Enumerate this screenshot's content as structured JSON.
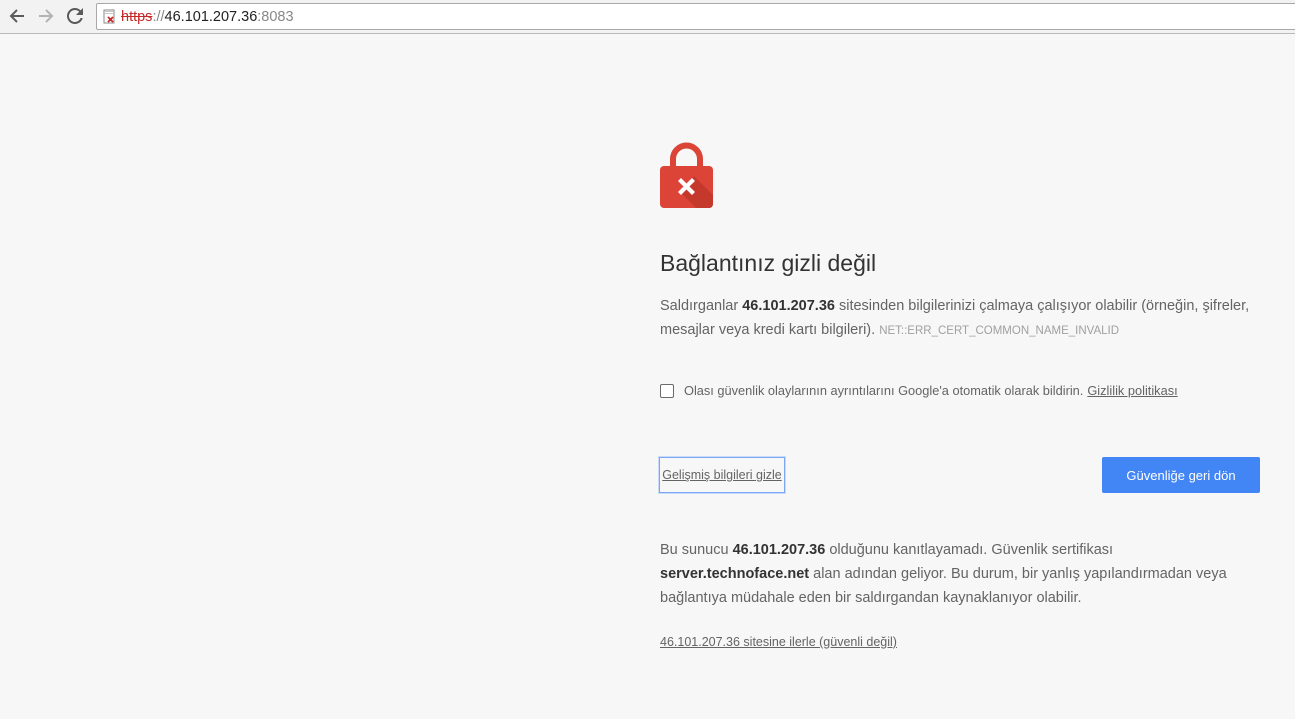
{
  "browser": {
    "back_icon": "arrow-left-icon",
    "forward_icon": "arrow-right-icon",
    "reload_icon": "reload-icon",
    "security_icon": "broken-lock-icon",
    "url": {
      "scheme": "https",
      "separator": "://",
      "host": "46.101.207.36",
      "port": ":8083"
    }
  },
  "interstitial": {
    "icon": "red-lock-error-icon",
    "accent_color": "#db4437",
    "heading": "Bağlantınız gizli değil",
    "summary": {
      "before": "Saldırganlar ",
      "host": "46.101.207.36",
      "after": " sitesinden bilgilerinizi çalmaya çalışıyor olabilir (örneğin, şifreler, mesajlar veya kredi kartı bilgileri). ",
      "error_code": "NET::ERR_CERT_COMMON_NAME_INVALID"
    },
    "report": {
      "checked": false,
      "label": "Olası güvenlik olaylarının ayrıntılarını Google'a otomatik olarak bildirin.",
      "privacy_link": "Gizlilik politikası"
    },
    "details_button": "Gelişmiş bilgileri gizle",
    "primary_button": "Güvenliğe geri dön",
    "primary_color": "#4285f4",
    "details": {
      "part1": "Bu sunucu ",
      "host": "46.101.207.36",
      "part2": " olduğunu kanıtlayamadı. Güvenlik sertifikası ",
      "cert_domain": "server.technoface.net",
      "part3": " alan adından geliyor. Bu durum, bir yanlış yapılandırmadan veya bağlantıya müdahale eden bir saldırgandan kaynaklanıyor olabilir."
    },
    "proceed_link": "46.101.207.36 sitesine ilerle (güvenli değil)"
  }
}
